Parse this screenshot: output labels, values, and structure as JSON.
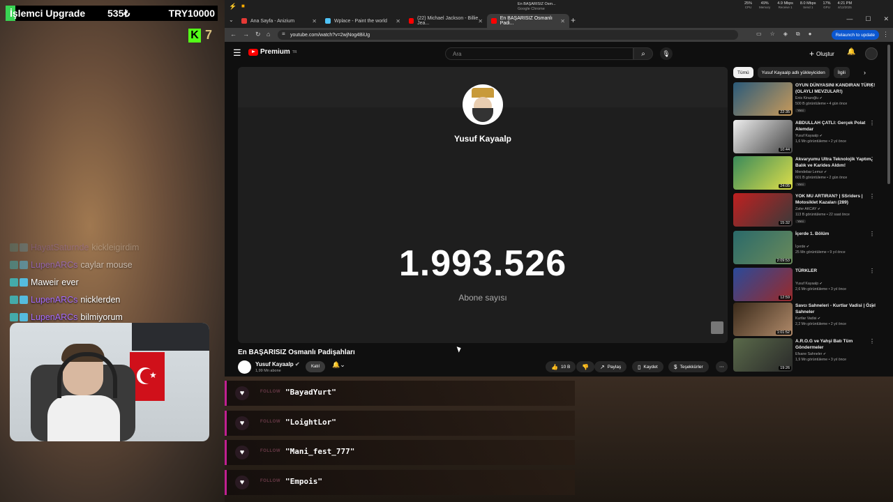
{
  "overlay": {
    "upgrade": {
      "title": "İşlemci Upgrade",
      "count": "535₺",
      "goal": "TRY10000"
    },
    "kick": {
      "letter": "K",
      "viewers": "7"
    },
    "chat": [
      {
        "user": "HayatSaturnde",
        "message": "kickleigirdim",
        "faded": "faded"
      },
      {
        "user": "LupenARCs",
        "message": "caylar mouse",
        "faded": "faded2"
      },
      {
        "user": "Maweir",
        "message": "ever",
        "faded": ""
      },
      {
        "user": "LupenARCs",
        "message": "nicklerden",
        "faded": ""
      },
      {
        "user": "LupenARCs",
        "message": "bilmiyorum",
        "faded": ""
      }
    ],
    "follows": [
      {
        "label": "FOLLOW",
        "name": "\"BayadYurt\""
      },
      {
        "label": "FOLLOW",
        "name": "\"LoightLor\""
      },
      {
        "label": "FOLLOW",
        "name": "\"Mani_fest_777\""
      },
      {
        "label": "FOLLOW",
        "name": "\"Empois\""
      }
    ]
  },
  "browser": {
    "window_title": "En BAŞARISIZ Osm...",
    "window_subtitle": "Google Chrome",
    "tabs": [
      {
        "label": "Ana Sayfa - Anizium",
        "color": "#e53935"
      },
      {
        "label": "Wplace - Paint the world",
        "color": "#4fc3f7"
      },
      {
        "label": "(22) Michael Jackson - Billie Jea...",
        "color": "#ff0000"
      },
      {
        "label": "En BAŞARISIZ Osmanlı Padi...",
        "color": "#ff0000"
      }
    ],
    "url": "youtube.com/watch?v=2wjNog4BiUg",
    "relaunch": "Relaunch to update",
    "stats": [
      {
        "value": "25%",
        "label": "CPU"
      },
      {
        "value": "49%",
        "label": "Memory"
      },
      {
        "value": "4.9 Mbps",
        "label": "Receive 1"
      },
      {
        "value": "8.0 Mbps",
        "label": "Send 1"
      },
      {
        "value": "17%",
        "label": "GPU"
      },
      {
        "value": "4:21 PM",
        "label": "4/12/2025"
      }
    ]
  },
  "youtube": {
    "logo": "Premium",
    "logo_sup": "TR",
    "search_placeholder": "Ara",
    "create_label": "Oluştur",
    "player": {
      "channel_name": "Yusuf Kayaalp",
      "subscriber_count": "1.993.526",
      "subscriber_label": "Abone sayısı"
    },
    "video_title": "En BAŞARISIZ Osmanlı Padişahları",
    "owner": {
      "name": "Yusuf Kayaalp",
      "subs": "1,99 Mn abone",
      "joined": "Katıl"
    },
    "actions": {
      "likes": "10 B",
      "share": "Paylaş",
      "save": "Kaydet",
      "thanks": "Teşekkürler"
    },
    "chips": [
      "Tümü",
      "Yusuf Kayaalp adlı yükleyiciden",
      "İlgili"
    ],
    "recommendations": [
      {
        "title": "OYUN DÜNYASINI KANDIRAN TÜRK! (OLAYLI MEVZULAR!)",
        "channel": "Enis Kirazoğlu",
        "meta": "500 B görüntüleme • 4 gün önce",
        "duration": "22:35",
        "badge": "Yeni",
        "thumb": "linear-gradient(135deg,#2a5a7a,#c89a5a)"
      },
      {
        "title": "ABDULLAH ÇATLI: Gerçek Polat Alemdar",
        "channel": "Yusuf Kayaalp",
        "meta": "1,6 Mn görüntüleme • 2 yıl önce",
        "duration": "10:44",
        "badge": "",
        "thumb": "linear-gradient(135deg,#eee,#444)"
      },
      {
        "title": "Akvaryumu Ultra Teknolojik Yaptım, Balık ve Karides Aldım!",
        "channel": "Mendebar Lemur",
        "meta": "601 B görüntüleme • 2 gün önce",
        "duration": "24:05",
        "badge": "Yeni",
        "thumb": "linear-gradient(135deg,#3a8a5a,#dede4a)"
      },
      {
        "title": "YOK MU ARTIRAN? | SSriders | Motosiklet Kazaları (289)",
        "channel": "Zafer AKCAY",
        "meta": "113 B görüntüleme • 22 saat önce",
        "duration": "15:32",
        "badge": "Yeni",
        "thumb": "linear-gradient(135deg,#c02020,#3a3a3a)"
      },
      {
        "title": "İçerde 1. Bölüm",
        "channel": "İçerde",
        "meta": "25 Mn görüntüleme • 9 yıl önce",
        "duration": "2:09:53",
        "badge": "",
        "thumb": "linear-gradient(135deg,#2a6a6a,#6a8a5a)"
      },
      {
        "title": "TÜRKLER",
        "channel": "Yusuf Kayaalp",
        "meta": "2,6 Mn görüntüleme • 3 yıl önce",
        "duration": "12:59",
        "badge": "",
        "thumb": "linear-gradient(135deg,#2a4a9a,#9a2a2a)"
      },
      {
        "title": "Savcı Sahneleri - Kurtlar Vadisi | Özel Sahneler",
        "channel": "Kurtlar Vadisi",
        "meta": "2,2 Mn görüntüleme • 2 yıl önce",
        "duration": "1:01:52",
        "badge": "",
        "thumb": "linear-gradient(135deg,#3a2a1a,#b08a6a)"
      },
      {
        "title": "A.R.O.G ve Yahşi Batı Tüm Göndermeler",
        "channel": "Efsane Sahneler",
        "meta": "1,9 Mn görüntüleme • 3 yıl önce",
        "duration": "19:26",
        "badge": "",
        "thumb": "linear-gradient(135deg,#5a6a4a,#2a2a2a)"
      }
    ]
  }
}
